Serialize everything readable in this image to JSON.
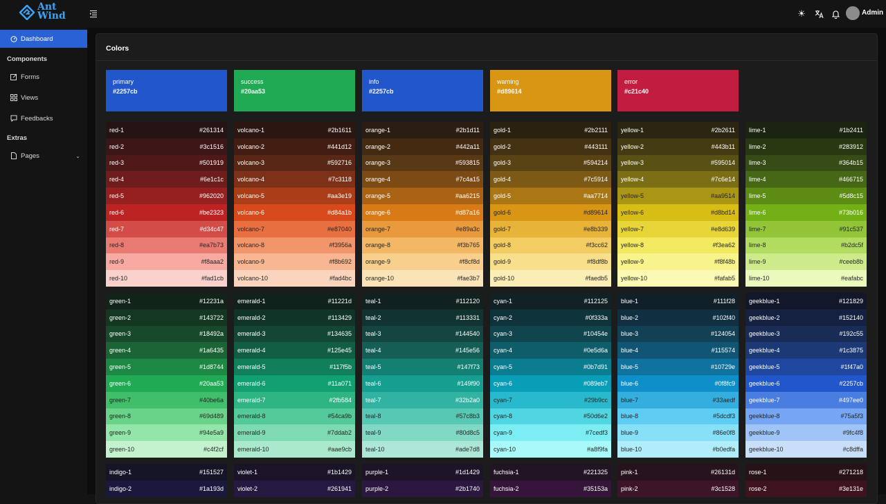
{
  "app": {
    "logo_line1": "Ant",
    "logo_line2": "Wind",
    "user": "Admin"
  },
  "header": {
    "icons": [
      "sun-icon",
      "translate-icon",
      "bell-icon"
    ]
  },
  "sidebar": {
    "items": [
      {
        "label": "Dashboard",
        "icon": "dashboard-icon",
        "active": true
      },
      {
        "group": "Components"
      },
      {
        "label": "Forms",
        "icon": "edit-icon"
      },
      {
        "label": "Views",
        "icon": "grid-icon"
      },
      {
        "label": "Feedbacks",
        "icon": "comment-icon"
      },
      {
        "group": "Extras"
      },
      {
        "label": "Pages",
        "icon": "file-icon",
        "chevron": true
      }
    ]
  },
  "page": {
    "title": "Colors"
  },
  "brand_colors": [
    {
      "name": "primary",
      "value": "#2257cb"
    },
    {
      "name": "success",
      "value": "#20aa53"
    },
    {
      "name": "info",
      "value": "#2257cb"
    },
    {
      "name": "warning",
      "value": "#d89614"
    },
    {
      "name": "error",
      "value": "#c21c40"
    }
  ],
  "palettes": [
    {
      "name": "red",
      "values": [
        "#261314",
        "#3c1516",
        "#501919",
        "#6e1c1c",
        "#962020",
        "#be2323",
        "#d34c47",
        "#ea7b73",
        "#f8aaa2",
        "#fad1cb"
      ]
    },
    {
      "name": "volcano",
      "values": [
        "#2b1611",
        "#441d12",
        "#592716",
        "#7c3118",
        "#aa3e19",
        "#d84a1b",
        "#e87040",
        "#f3956a",
        "#f8b692",
        "#fad4bc"
      ]
    },
    {
      "name": "orange",
      "values": [
        "#2b1d11",
        "#442a11",
        "#593815",
        "#7c4a15",
        "#aa6215",
        "#d87a16",
        "#e89a3c",
        "#f3b765",
        "#f8cf8d",
        "#fae3b7"
      ]
    },
    {
      "name": "gold",
      "values": [
        "#2b2111",
        "#443111",
        "#594214",
        "#7c5914",
        "#aa7714",
        "#d89614",
        "#e8b339",
        "#f3cc62",
        "#f8df8b",
        "#faedb5"
      ]
    },
    {
      "name": "yellow",
      "values": [
        "#2b2611",
        "#443b11",
        "#595014",
        "#7c6e14",
        "#aa9514",
        "#d8bd14",
        "#e8d639",
        "#f3ea62",
        "#f8f48b",
        "#fafab5"
      ]
    },
    {
      "name": "lime",
      "values": [
        "#1b2411",
        "#283912",
        "#364b15",
        "#466715",
        "#5d8c15",
        "#73b016",
        "#91c537",
        "#b2dc5f",
        "#ceeb8b",
        "#eafabc"
      ]
    },
    {
      "name": "green",
      "values": [
        "#12231a",
        "#143722",
        "#18492a",
        "#1a6435",
        "#1d8744",
        "#20aa53",
        "#40be6a",
        "#69d489",
        "#94e5a9",
        "#c4f2cf"
      ]
    },
    {
      "name": "emerald",
      "values": [
        "#11221d",
        "#113429",
        "#134635",
        "#125e45",
        "#117f5b",
        "#11a071",
        "#2fb584",
        "#54ca9b",
        "#7ddab2",
        "#aae9cb"
      ]
    },
    {
      "name": "teal",
      "values": [
        "#112120",
        "#113331",
        "#144540",
        "#145e56",
        "#147f73",
        "#149f90",
        "#32b2a0",
        "#57c8b3",
        "#80d8c5",
        "#ade7d8"
      ]
    },
    {
      "name": "cyan",
      "values": [
        "#112125",
        "#0f333a",
        "#10454e",
        "#0e5d6a",
        "#0b7d91",
        "#089eb7",
        "#29b9cc",
        "#50d6e2",
        "#7cedf3",
        "#a8f9fa"
      ]
    },
    {
      "name": "blue",
      "values": [
        "#111f28",
        "#102f40",
        "#124054",
        "#115574",
        "#10729e",
        "#0f8fc9",
        "#33aedf",
        "#5dcdf3",
        "#86e0f8",
        "#b0edfa"
      ]
    },
    {
      "name": "geekblue",
      "values": [
        "#121829",
        "#152140",
        "#192c55",
        "#1c3875",
        "#1f47a0",
        "#2257cb",
        "#497ee0",
        "#75a5f3",
        "#9fc4f8",
        "#c8dffa"
      ]
    },
    {
      "name": "indigo",
      "values": [
        "#151527",
        "#1a193d"
      ]
    },
    {
      "name": "violet",
      "values": [
        "#1b1429",
        "#261941"
      ]
    },
    {
      "name": "purple",
      "values": [
        "#1d1429",
        "#2b1740"
      ]
    },
    {
      "name": "fuchsia",
      "values": [
        "#221325",
        "#35153a"
      ]
    },
    {
      "name": "pink",
      "values": [
        "#26131d",
        "#3c1528"
      ]
    },
    {
      "name": "rose",
      "values": [
        "#271218",
        "#3e131e"
      ]
    }
  ]
}
